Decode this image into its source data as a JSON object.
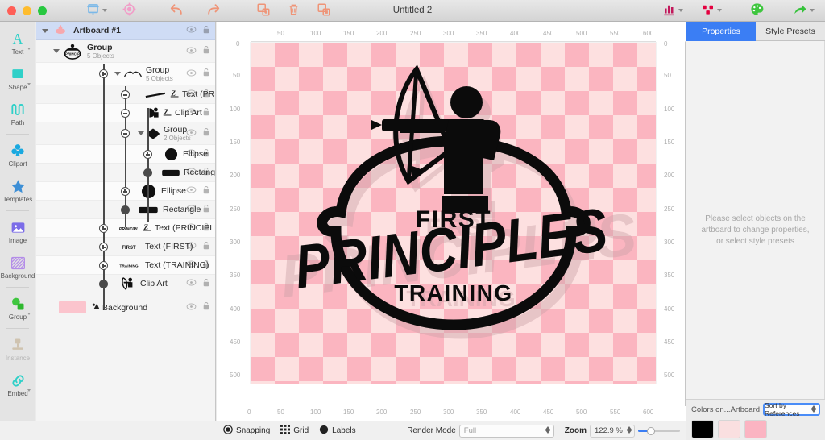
{
  "window": {
    "title": "Untitled 2",
    "traffic_lights": [
      "close",
      "minimize",
      "zoom"
    ]
  },
  "toolbar": {
    "items": [
      {
        "name": "artboard-tool",
        "icon": "artboard-icon",
        "has_caret": true
      },
      {
        "name": "target-tool",
        "icon": "target-icon",
        "has_caret": false
      },
      {
        "name": "undo",
        "icon": "undo-arrow-icon",
        "has_caret": false
      },
      {
        "name": "redo",
        "icon": "redo-arrow-icon",
        "has_caret": false
      },
      {
        "name": "duplicate",
        "icon": "duplicate-icon",
        "has_caret": false
      },
      {
        "name": "delete",
        "icon": "trash-icon",
        "has_caret": false
      },
      {
        "name": "copy-style",
        "icon": "copy-style-icon",
        "has_caret": false
      },
      {
        "name": "chart",
        "icon": "chart-icon",
        "has_caret": true
      },
      {
        "name": "distribute",
        "icon": "distribute-icon",
        "has_caret": true
      },
      {
        "name": "palette",
        "icon": "palette-icon",
        "has_caret": false
      },
      {
        "name": "share",
        "icon": "share-arrow-icon",
        "has_caret": true
      }
    ]
  },
  "tools": [
    {
      "label": "Text",
      "icon": "text-tool-icon",
      "caret": true,
      "disabled": false
    },
    {
      "label": "Shape",
      "icon": "shape-tool-icon",
      "caret": true,
      "disabled": false
    },
    {
      "label": "Path",
      "icon": "path-tool-icon",
      "caret": false,
      "disabled": false
    },
    {
      "label": "Clipart",
      "icon": "clipart-tool-icon",
      "caret": false,
      "disabled": false
    },
    {
      "label": "Templates",
      "icon": "templates-tool-icon",
      "caret": false,
      "disabled": false
    },
    {
      "label": "Image",
      "icon": "image-tool-icon",
      "caret": false,
      "disabled": false
    },
    {
      "label": "Background",
      "icon": "background-tool-icon",
      "caret": false,
      "disabled": false
    },
    {
      "label": "Group",
      "icon": "group-tool-icon",
      "caret": true,
      "disabled": false
    },
    {
      "label": "Instance",
      "icon": "instance-tool-icon",
      "caret": false,
      "disabled": true
    },
    {
      "label": "Embed",
      "icon": "embed-tool-icon",
      "caret": true,
      "disabled": false
    }
  ],
  "layers": {
    "rows": [
      {
        "name": "Artboard #1",
        "sub": "",
        "indent": 0,
        "selected": true,
        "disclosure": "open",
        "thumb": "artboard-thumb"
      },
      {
        "name": "Group",
        "sub": "5 Objects",
        "indent": 1,
        "selected": false,
        "disclosure": "open",
        "thumb": "logo-thumb"
      },
      {
        "name": "Group",
        "sub": "5 Objects",
        "indent": 2,
        "selected": false,
        "disclosure": "open",
        "thumb": "arc-thumb"
      },
      {
        "name": "Text (PRINCI...",
        "sub": "",
        "indent": 3,
        "selected": false,
        "disclosure": "none",
        "thumb": "text-thumb"
      },
      {
        "name": "Clip Art",
        "sub": "",
        "indent": 3,
        "selected": false,
        "disclosure": "none",
        "thumb": "clipart-thumb"
      },
      {
        "name": "Group",
        "sub": "2 Objects",
        "indent": 3,
        "selected": false,
        "disclosure": "open",
        "thumb": "blob-thumb"
      },
      {
        "name": "Ellipse",
        "sub": "",
        "indent": 4,
        "selected": false,
        "disclosure": "none",
        "thumb": "ellipse-thumb"
      },
      {
        "name": "Rectangle",
        "sub": "",
        "indent": 4,
        "selected": false,
        "disclosure": "none",
        "thumb": "rect-thumb"
      },
      {
        "name": "Ellipse",
        "sub": "",
        "indent": 2,
        "selected": false,
        "disclosure": "none",
        "thumb": "ellipse-thumb"
      },
      {
        "name": "Rectangle",
        "sub": "",
        "indent": 2,
        "selected": false,
        "disclosure": "none",
        "thumb": "rect-thumb"
      },
      {
        "name": "Text (PRINCIPLES)",
        "sub": "",
        "indent": 1,
        "selected": false,
        "disclosure": "none",
        "thumb": "text-principles-thumb"
      },
      {
        "name": "Text (FIRST)",
        "sub": "",
        "indent": 1,
        "selected": false,
        "disclosure": "none",
        "thumb": "text-first-thumb"
      },
      {
        "name": "Text (TRAINING)",
        "sub": "",
        "indent": 1,
        "selected": false,
        "disclosure": "none",
        "thumb": "text-training-thumb"
      },
      {
        "name": "Clip Art",
        "sub": "",
        "indent": 1,
        "selected": false,
        "disclosure": "none",
        "thumb": "archer-thumb"
      },
      {
        "name": "Background",
        "sub": "",
        "indent": 0,
        "selected": false,
        "disclosure": "none",
        "thumb": "background-swatch"
      }
    ]
  },
  "canvas": {
    "ruler_h_ticks": [
      "0",
      "50",
      "100",
      "150",
      "200",
      "250",
      "300",
      "350",
      "400",
      "450",
      "500",
      "550",
      "600"
    ],
    "ruler_v_ticks": [
      "0",
      "50",
      "100",
      "150",
      "200",
      "250",
      "300",
      "350",
      "400",
      "450",
      "500"
    ],
    "origin_label": "0",
    "artwork": {
      "line1": "FIRST",
      "line2": "PRINCIPLES",
      "line3": "TRAINING",
      "ink_color": "#0b0b0b",
      "shadow_color": "#d9a5ad",
      "checker_light": "#fde0e0",
      "checker_dark": "#fbb5c0"
    }
  },
  "right_panel": {
    "tabs": [
      {
        "label": "Properties",
        "active": true
      },
      {
        "label": "Style Presets",
        "active": false
      }
    ],
    "empty_message": "Please select objects on the artboard to change properties, or select style presets",
    "colors_label": "Colors on...Artboard",
    "sort_value": "Sort by References",
    "swatches": [
      "#000000",
      "#fadfe0",
      "#fbb4c2"
    ]
  },
  "bottom_bar": {
    "snapping_label": "Snapping",
    "grid_label": "Grid",
    "labels_label": "Labels",
    "render_mode_label": "Render Mode",
    "render_mode_value": "Full",
    "zoom_label": "Zoom",
    "zoom_value": "122.9 %"
  }
}
